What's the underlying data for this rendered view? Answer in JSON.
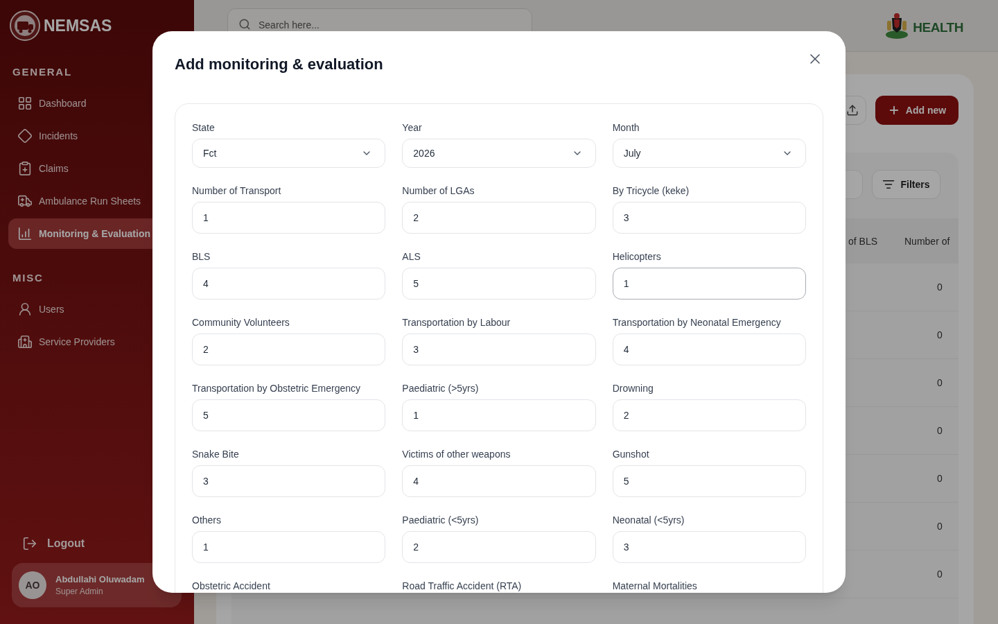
{
  "sidebar": {
    "brand": "NEMSAS",
    "sections": [
      {
        "heading": "GENERAL",
        "items": [
          {
            "label": "Dashboard",
            "selected": false
          },
          {
            "label": "Incidents",
            "selected": false
          },
          {
            "label": "Claims",
            "selected": false
          },
          {
            "label": "Ambulance Run Sheets",
            "selected": false
          },
          {
            "label": "Monitoring & Evaluation",
            "selected": true
          }
        ]
      },
      {
        "heading": "MISC",
        "items": [
          {
            "label": "Users",
            "selected": false
          },
          {
            "label": "Service Providers",
            "selected": false
          }
        ]
      }
    ],
    "logout": "Logout",
    "user": {
      "initials": "AO",
      "name": "Abdullahi Oluwadam",
      "role": "Super Admin"
    }
  },
  "header": {
    "search": {
      "placeholder": "Search here..."
    },
    "logo": "HEALTH"
  },
  "page": {
    "add_button": "Add new",
    "filters_button": "Filters",
    "table": {
      "columns": [
        "of BLS",
        "Number of"
      ],
      "rows": [
        {
          "column_2": "0"
        },
        {
          "column_2": "0"
        },
        {
          "column_2": "0"
        },
        {
          "column_2": "0"
        },
        {
          "column_2": "0"
        },
        {
          "column_2": "0"
        },
        {
          "column_2": "0"
        }
      ]
    }
  },
  "modal": {
    "title": "Add monitoring & evaluation",
    "fields": [
      {
        "label": "State",
        "kind": "select",
        "value": "Fct",
        "focused": false
      },
      {
        "label": "Year",
        "kind": "select",
        "value": "2026",
        "focused": false
      },
      {
        "label": "Month",
        "kind": "select",
        "value": "July",
        "focused": false
      },
      {
        "label": "Number of Transport",
        "kind": "number",
        "value": "1",
        "focused": false
      },
      {
        "label": "Number of LGAs",
        "kind": "number",
        "value": "2",
        "focused": false
      },
      {
        "label": "By Tricycle (keke)",
        "kind": "number",
        "value": "3",
        "focused": false
      },
      {
        "label": "BLS",
        "kind": "number",
        "value": "4",
        "focused": false
      },
      {
        "label": "ALS",
        "kind": "number",
        "value": "5",
        "focused": false
      },
      {
        "label": "Helicopters",
        "kind": "number",
        "value": "1",
        "focused": true
      },
      {
        "label": "Community Volunteers",
        "kind": "number",
        "value": "2",
        "focused": false
      },
      {
        "label": "Transportation by Labour",
        "kind": "number",
        "value": "3",
        "focused": false
      },
      {
        "label": "Transportation by Neonatal Emergency",
        "kind": "number",
        "value": "4",
        "focused": false
      },
      {
        "label": "Transportation by Obstetric Emergency",
        "kind": "number",
        "value": "5",
        "focused": false
      },
      {
        "label": "Paediatric (>5yrs)",
        "kind": "number",
        "value": "1",
        "focused": false
      },
      {
        "label": "Drowning",
        "kind": "number",
        "value": "2",
        "focused": false
      },
      {
        "label": "Snake Bite",
        "kind": "number",
        "value": "3",
        "focused": false
      },
      {
        "label": "Victims of other weapons",
        "kind": "number",
        "value": "4",
        "focused": false
      },
      {
        "label": "Gunshot",
        "kind": "number",
        "value": "5",
        "focused": false
      },
      {
        "label": "Others",
        "kind": "number",
        "value": "1",
        "focused": false
      },
      {
        "label": "Paediatric (<5yrs)",
        "kind": "number",
        "value": "2",
        "focused": false
      },
      {
        "label": "Neonatal (<5yrs)",
        "kind": "number",
        "value": "3",
        "focused": false
      },
      {
        "label": "Obstetric Accident"
      },
      {
        "label": "Road Traffic Accident (RTA)"
      },
      {
        "label": "Maternal Mortalities"
      }
    ]
  }
}
